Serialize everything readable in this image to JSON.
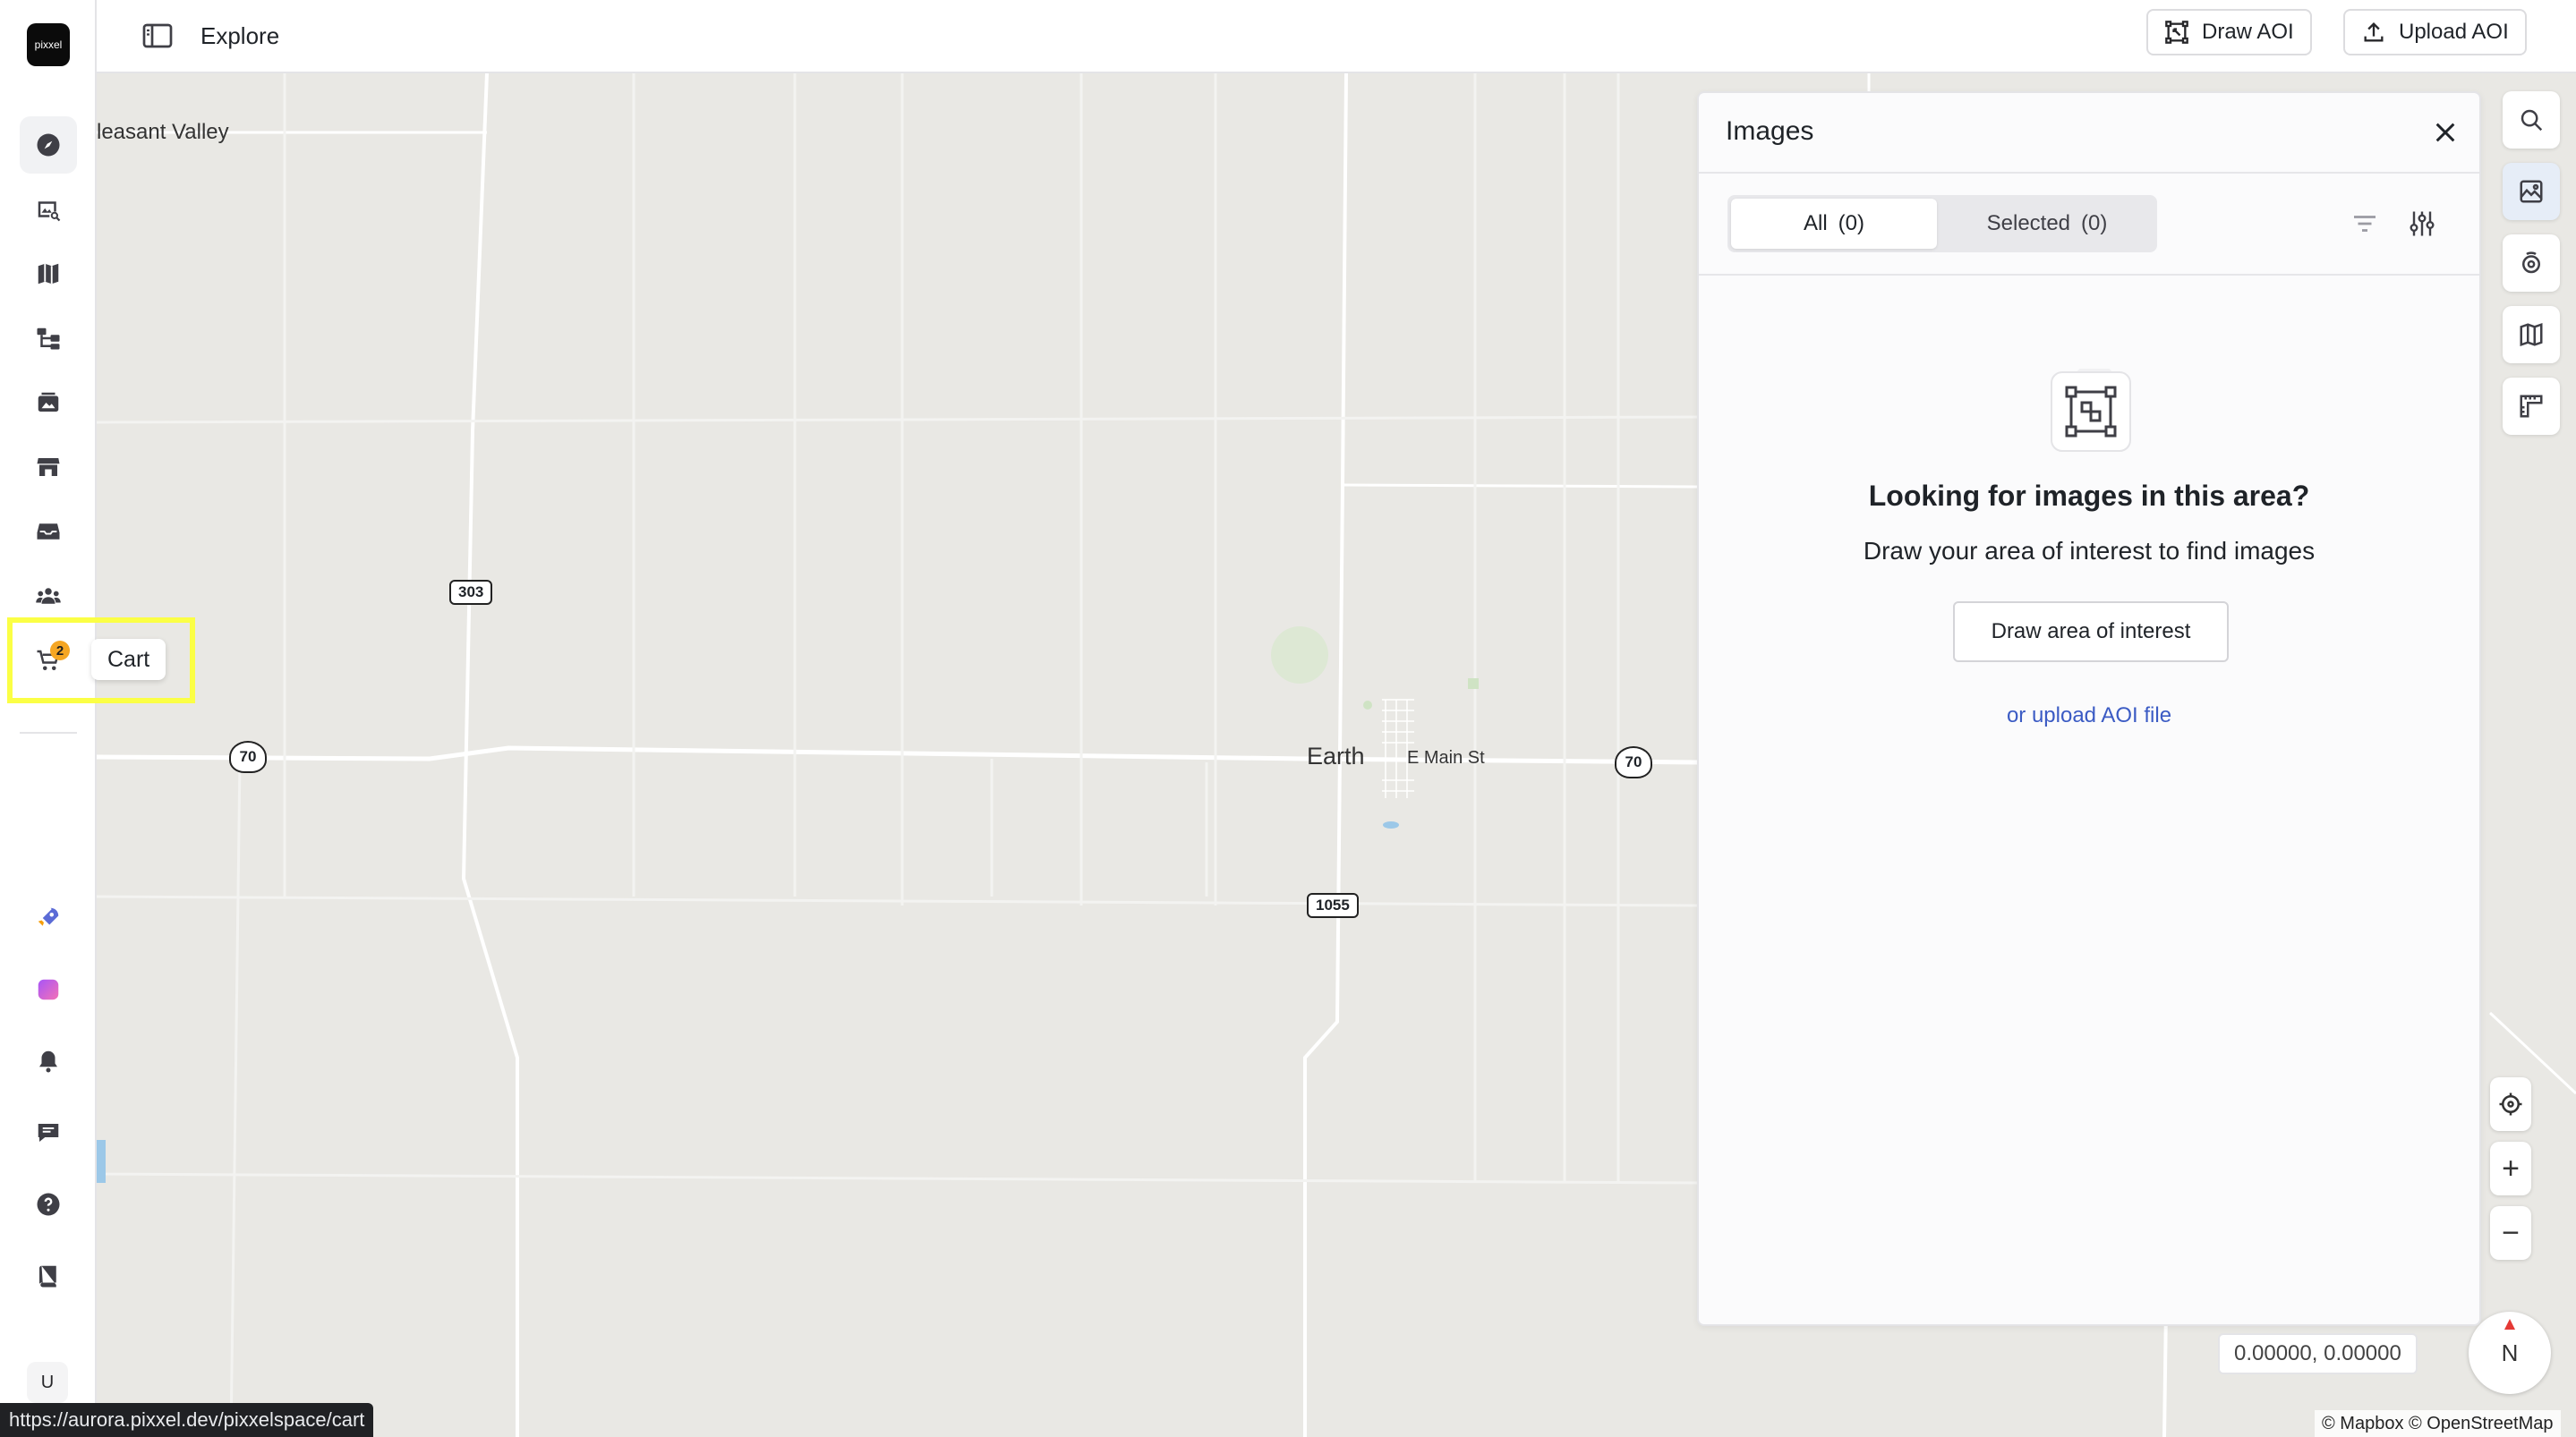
{
  "app": {
    "logo_text": "pixxel"
  },
  "header": {
    "title": "Explore",
    "draw_aoi_label": "Draw AOI",
    "upload_aoi_label": "Upload AOI"
  },
  "sidebar": {
    "items": [
      {
        "name": "explore",
        "icon": "compass-icon"
      },
      {
        "name": "images",
        "icon": "image-search-icon"
      },
      {
        "name": "maps",
        "icon": "map-icon"
      },
      {
        "name": "workflows",
        "icon": "workflow-icon"
      },
      {
        "name": "gallery",
        "icon": "photos-icon"
      },
      {
        "name": "store",
        "icon": "store-icon"
      },
      {
        "name": "inbox",
        "icon": "inbox-icon"
      },
      {
        "name": "team",
        "icon": "team-icon"
      },
      {
        "name": "cart",
        "icon": "cart-icon",
        "badge": "2"
      }
    ],
    "bottom_items": [
      {
        "name": "launch",
        "icon": "rocket-icon"
      },
      {
        "name": "apps",
        "icon": "gradient-app-icon"
      },
      {
        "name": "notifications",
        "icon": "bell-icon"
      },
      {
        "name": "feedback",
        "icon": "chat-icon"
      },
      {
        "name": "help",
        "icon": "help-icon"
      },
      {
        "name": "docs",
        "icon": "book-icon"
      }
    ],
    "avatar_initial": "U"
  },
  "tooltip": {
    "text": "Cart"
  },
  "map": {
    "labels": {
      "place_valley": "leasant Valley",
      "place_earth": "Earth",
      "street_main": "E Main St"
    },
    "shields": {
      "r303": "303",
      "us70_west": "70",
      "us70_east": "70",
      "r1055": "1055"
    },
    "coordinates": "0.00000, 0.00000",
    "attribution": "© Mapbox © OpenStreetMap",
    "compass_label": "N",
    "zoom_in_label": "+",
    "zoom_out_label": "−"
  },
  "panel": {
    "title": "Images",
    "tabs": [
      {
        "label": "All",
        "count": "(0)",
        "active": true
      },
      {
        "label": "Selected",
        "count": "(0)",
        "active": false
      }
    ],
    "empty_title": "Looking for images in this area?",
    "empty_subtitle": "Draw your area of interest to find images",
    "draw_button_label": "Draw area of interest",
    "upload_link": "or upload AOI file"
  },
  "status_url": "https://aurora.pixxel.dev/pixxelspace/cart",
  "colors": {
    "accent_link": "#3b5bc4",
    "highlight": "#fbff45",
    "badge": "#f5a623",
    "map_bg": "#e9e8e4"
  }
}
